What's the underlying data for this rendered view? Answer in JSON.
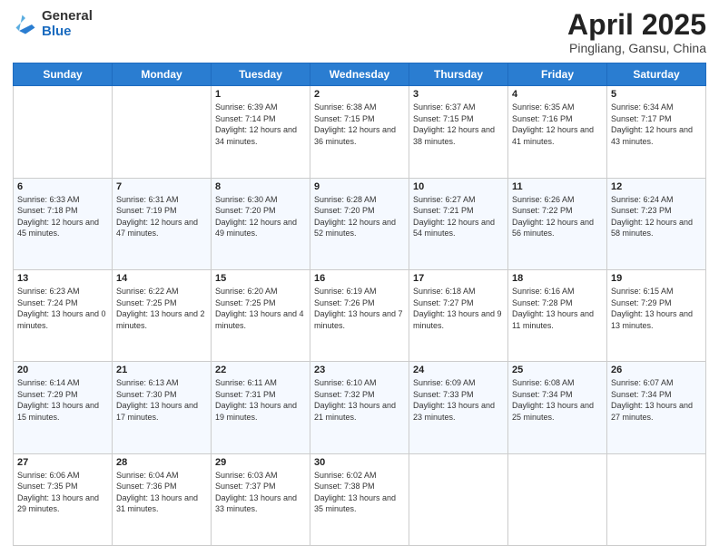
{
  "header": {
    "logo_general": "General",
    "logo_blue": "Blue",
    "title": "April 2025",
    "location": "Pingliang, Gansu, China"
  },
  "days_of_week": [
    "Sunday",
    "Monday",
    "Tuesday",
    "Wednesday",
    "Thursday",
    "Friday",
    "Saturday"
  ],
  "weeks": [
    [
      {
        "day": "",
        "sunrise": "",
        "sunset": "",
        "daylight": ""
      },
      {
        "day": "",
        "sunrise": "",
        "sunset": "",
        "daylight": ""
      },
      {
        "day": "1",
        "sunrise": "Sunrise: 6:39 AM",
        "sunset": "Sunset: 7:14 PM",
        "daylight": "Daylight: 12 hours and 34 minutes."
      },
      {
        "day": "2",
        "sunrise": "Sunrise: 6:38 AM",
        "sunset": "Sunset: 7:15 PM",
        "daylight": "Daylight: 12 hours and 36 minutes."
      },
      {
        "day": "3",
        "sunrise": "Sunrise: 6:37 AM",
        "sunset": "Sunset: 7:15 PM",
        "daylight": "Daylight: 12 hours and 38 minutes."
      },
      {
        "day": "4",
        "sunrise": "Sunrise: 6:35 AM",
        "sunset": "Sunset: 7:16 PM",
        "daylight": "Daylight: 12 hours and 41 minutes."
      },
      {
        "day": "5",
        "sunrise": "Sunrise: 6:34 AM",
        "sunset": "Sunset: 7:17 PM",
        "daylight": "Daylight: 12 hours and 43 minutes."
      }
    ],
    [
      {
        "day": "6",
        "sunrise": "Sunrise: 6:33 AM",
        "sunset": "Sunset: 7:18 PM",
        "daylight": "Daylight: 12 hours and 45 minutes."
      },
      {
        "day": "7",
        "sunrise": "Sunrise: 6:31 AM",
        "sunset": "Sunset: 7:19 PM",
        "daylight": "Daylight: 12 hours and 47 minutes."
      },
      {
        "day": "8",
        "sunrise": "Sunrise: 6:30 AM",
        "sunset": "Sunset: 7:20 PM",
        "daylight": "Daylight: 12 hours and 49 minutes."
      },
      {
        "day": "9",
        "sunrise": "Sunrise: 6:28 AM",
        "sunset": "Sunset: 7:20 PM",
        "daylight": "Daylight: 12 hours and 52 minutes."
      },
      {
        "day": "10",
        "sunrise": "Sunrise: 6:27 AM",
        "sunset": "Sunset: 7:21 PM",
        "daylight": "Daylight: 12 hours and 54 minutes."
      },
      {
        "day": "11",
        "sunrise": "Sunrise: 6:26 AM",
        "sunset": "Sunset: 7:22 PM",
        "daylight": "Daylight: 12 hours and 56 minutes."
      },
      {
        "day": "12",
        "sunrise": "Sunrise: 6:24 AM",
        "sunset": "Sunset: 7:23 PM",
        "daylight": "Daylight: 12 hours and 58 minutes."
      }
    ],
    [
      {
        "day": "13",
        "sunrise": "Sunrise: 6:23 AM",
        "sunset": "Sunset: 7:24 PM",
        "daylight": "Daylight: 13 hours and 0 minutes."
      },
      {
        "day": "14",
        "sunrise": "Sunrise: 6:22 AM",
        "sunset": "Sunset: 7:25 PM",
        "daylight": "Daylight: 13 hours and 2 minutes."
      },
      {
        "day": "15",
        "sunrise": "Sunrise: 6:20 AM",
        "sunset": "Sunset: 7:25 PM",
        "daylight": "Daylight: 13 hours and 4 minutes."
      },
      {
        "day": "16",
        "sunrise": "Sunrise: 6:19 AM",
        "sunset": "Sunset: 7:26 PM",
        "daylight": "Daylight: 13 hours and 7 minutes."
      },
      {
        "day": "17",
        "sunrise": "Sunrise: 6:18 AM",
        "sunset": "Sunset: 7:27 PM",
        "daylight": "Daylight: 13 hours and 9 minutes."
      },
      {
        "day": "18",
        "sunrise": "Sunrise: 6:16 AM",
        "sunset": "Sunset: 7:28 PM",
        "daylight": "Daylight: 13 hours and 11 minutes."
      },
      {
        "day": "19",
        "sunrise": "Sunrise: 6:15 AM",
        "sunset": "Sunset: 7:29 PM",
        "daylight": "Daylight: 13 hours and 13 minutes."
      }
    ],
    [
      {
        "day": "20",
        "sunrise": "Sunrise: 6:14 AM",
        "sunset": "Sunset: 7:29 PM",
        "daylight": "Daylight: 13 hours and 15 minutes."
      },
      {
        "day": "21",
        "sunrise": "Sunrise: 6:13 AM",
        "sunset": "Sunset: 7:30 PM",
        "daylight": "Daylight: 13 hours and 17 minutes."
      },
      {
        "day": "22",
        "sunrise": "Sunrise: 6:11 AM",
        "sunset": "Sunset: 7:31 PM",
        "daylight": "Daylight: 13 hours and 19 minutes."
      },
      {
        "day": "23",
        "sunrise": "Sunrise: 6:10 AM",
        "sunset": "Sunset: 7:32 PM",
        "daylight": "Daylight: 13 hours and 21 minutes."
      },
      {
        "day": "24",
        "sunrise": "Sunrise: 6:09 AM",
        "sunset": "Sunset: 7:33 PM",
        "daylight": "Daylight: 13 hours and 23 minutes."
      },
      {
        "day": "25",
        "sunrise": "Sunrise: 6:08 AM",
        "sunset": "Sunset: 7:34 PM",
        "daylight": "Daylight: 13 hours and 25 minutes."
      },
      {
        "day": "26",
        "sunrise": "Sunrise: 6:07 AM",
        "sunset": "Sunset: 7:34 PM",
        "daylight": "Daylight: 13 hours and 27 minutes."
      }
    ],
    [
      {
        "day": "27",
        "sunrise": "Sunrise: 6:06 AM",
        "sunset": "Sunset: 7:35 PM",
        "daylight": "Daylight: 13 hours and 29 minutes."
      },
      {
        "day": "28",
        "sunrise": "Sunrise: 6:04 AM",
        "sunset": "Sunset: 7:36 PM",
        "daylight": "Daylight: 13 hours and 31 minutes."
      },
      {
        "day": "29",
        "sunrise": "Sunrise: 6:03 AM",
        "sunset": "Sunset: 7:37 PM",
        "daylight": "Daylight: 13 hours and 33 minutes."
      },
      {
        "day": "30",
        "sunrise": "Sunrise: 6:02 AM",
        "sunset": "Sunset: 7:38 PM",
        "daylight": "Daylight: 13 hours and 35 minutes."
      },
      {
        "day": "",
        "sunrise": "",
        "sunset": "",
        "daylight": ""
      },
      {
        "day": "",
        "sunrise": "",
        "sunset": "",
        "daylight": ""
      },
      {
        "day": "",
        "sunrise": "",
        "sunset": "",
        "daylight": ""
      }
    ]
  ]
}
